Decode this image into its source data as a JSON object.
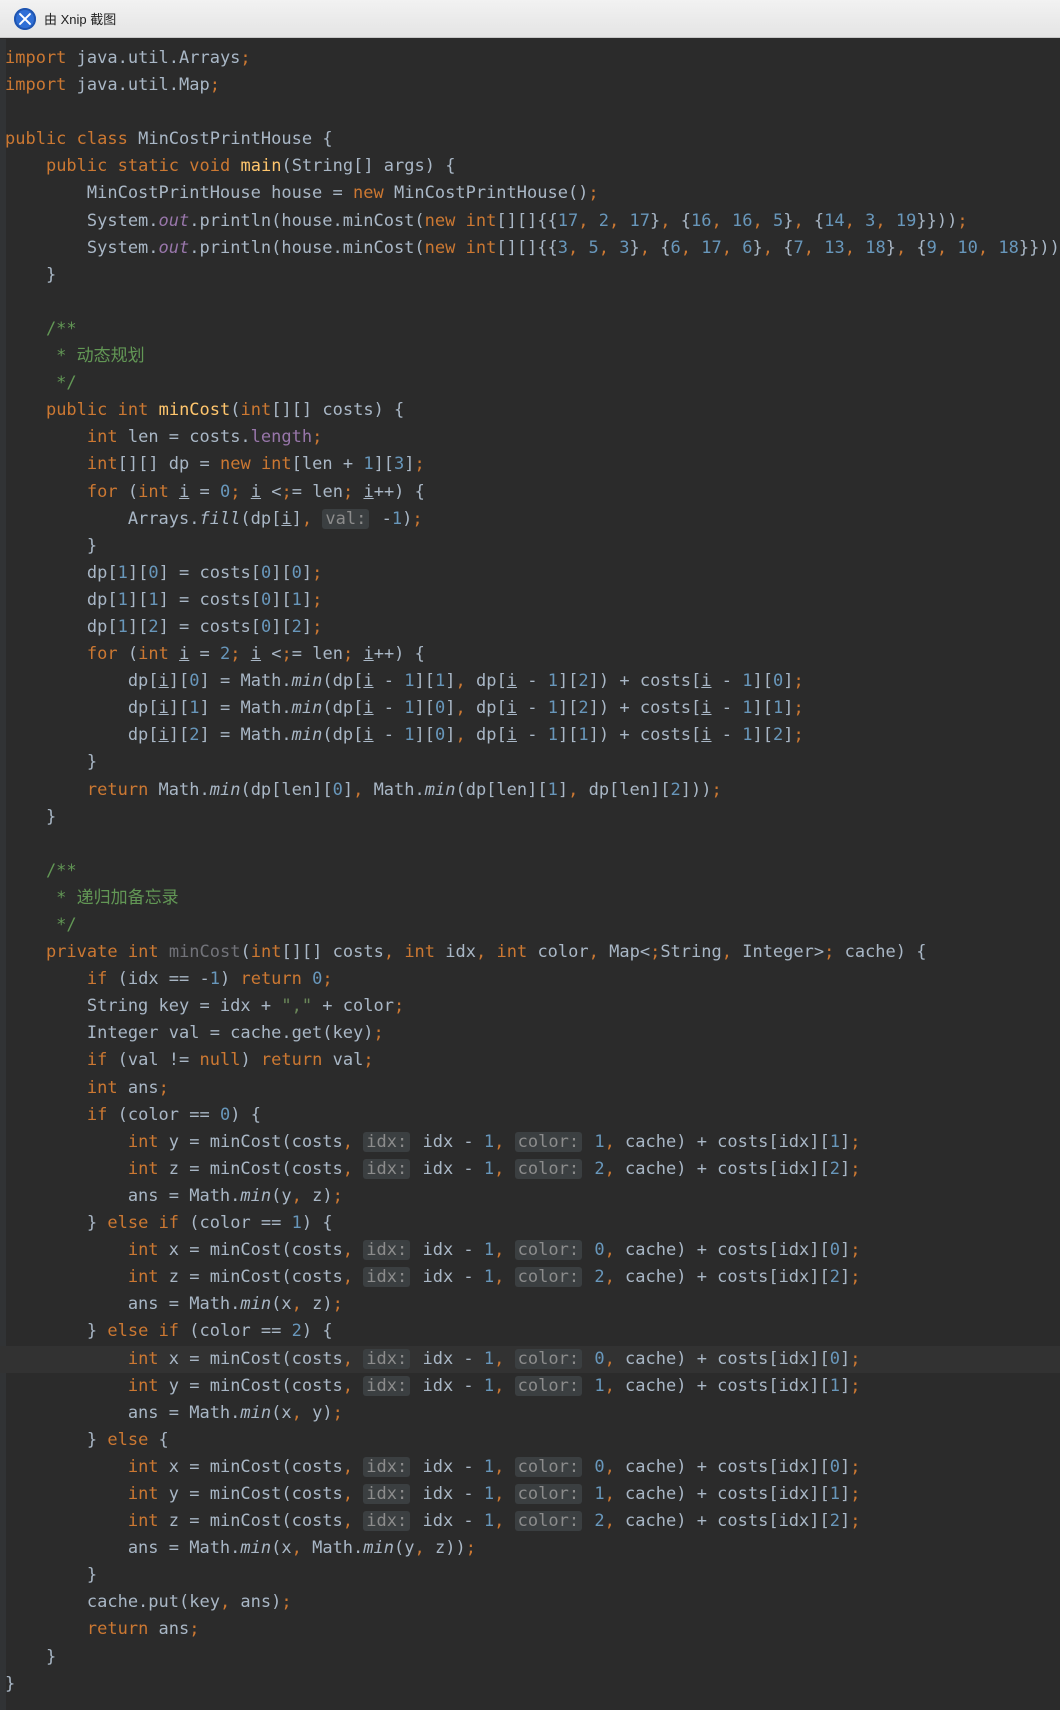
{
  "window": {
    "title": "由 Xnip 截图"
  },
  "editor": {
    "language": "java",
    "colors": {
      "background": "#2b2b2b",
      "keyword": "#cc7832",
      "number": "#6897bb",
      "comment": "#629755",
      "method_decl": "#ffc66d",
      "static_field": "#9876aa"
    },
    "lines": [
      "import java.util.Arrays;",
      "import java.util.Map;",
      "",
      "public class MinCostPrintHouse {",
      "    public static void main(String[] args) {",
      "        MinCostPrintHouse house = new MinCostPrintHouse();",
      "        System.out.println(house.minCost(new int[][]{{17, 2, 17}, {16, 16, 5}, {14, 3, 19}}));",
      "        System.out.println(house.minCost(new int[][]{{3, 5, 3}, {6, 17, 6}, {7, 13, 18}, {9, 10, 18}}));",
      "    }",
      "",
      "    /**",
      "     * 动态规划",
      "     */",
      "    public int minCost(int[][] costs) {",
      "        int len = costs.length;",
      "        int[][] dp = new int[len + 1][3];",
      "        for (int i = 0; i <= len; i++) {",
      "            Arrays.fill(dp[i], val: -1);",
      "        }",
      "        dp[1][0] = costs[0][0];",
      "        dp[1][1] = costs[0][1];",
      "        dp[1][2] = costs[0][2];",
      "        for (int i = 2; i <= len; i++) {",
      "            dp[i][0] = Math.min(dp[i - 1][1], dp[i - 1][2]) + costs[i - 1][0];",
      "            dp[i][1] = Math.min(dp[i - 1][0], dp[i - 1][2]) + costs[i - 1][1];",
      "            dp[i][2] = Math.min(dp[i - 1][0], dp[i - 1][1]) + costs[i - 1][2];",
      "        }",
      "        return Math.min(dp[len][0], Math.min(dp[len][1], dp[len][2]));",
      "    }",
      "",
      "    /**",
      "     * 递归加备忘录",
      "     */",
      "    private int minCost(int[][] costs, int idx, int color, Map<String, Integer> cache) {",
      "        if (idx == -1) return 0;",
      "        String key = idx + \",\" + color;",
      "        Integer val = cache.get(key);",
      "        if (val != null) return val;",
      "        int ans;",
      "        if (color == 0) {",
      "            int y = minCost(costs, idx: idx - 1, color: 1, cache) + costs[idx][1];",
      "            int z = minCost(costs, idx: idx - 1, color: 2, cache) + costs[idx][2];",
      "            ans = Math.min(y, z);",
      "        } else if (color == 1) {",
      "            int x = minCost(costs, idx: idx - 1, color: 0, cache) + costs[idx][0];",
      "            int z = minCost(costs, idx: idx - 1, color: 2, cache) + costs[idx][2];",
      "            ans = Math.min(x, z);",
      "        } else if (color == 2) {",
      "            int x = minCost(costs, idx: idx - 1, color: 0, cache) + costs[idx][0];",
      "            int y = minCost(costs, idx: idx - 1, color: 1, cache) + costs[idx][1];",
      "            ans = Math.min(x, y);",
      "        } else {",
      "            int x = minCost(costs, idx: idx - 1, color: 0, cache) + costs[idx][0];",
      "            int y = minCost(costs, idx: idx - 1, color: 1, cache) + costs[idx][1];",
      "            int z = minCost(costs, idx: idx - 1, color: 2, cache) + costs[idx][2];",
      "            ans = Math.min(x, Math.min(y, z));",
      "        }",
      "        cache.put(key, ans);",
      "        return ans;",
      "    }",
      "}"
    ],
    "current_line": 48
  }
}
